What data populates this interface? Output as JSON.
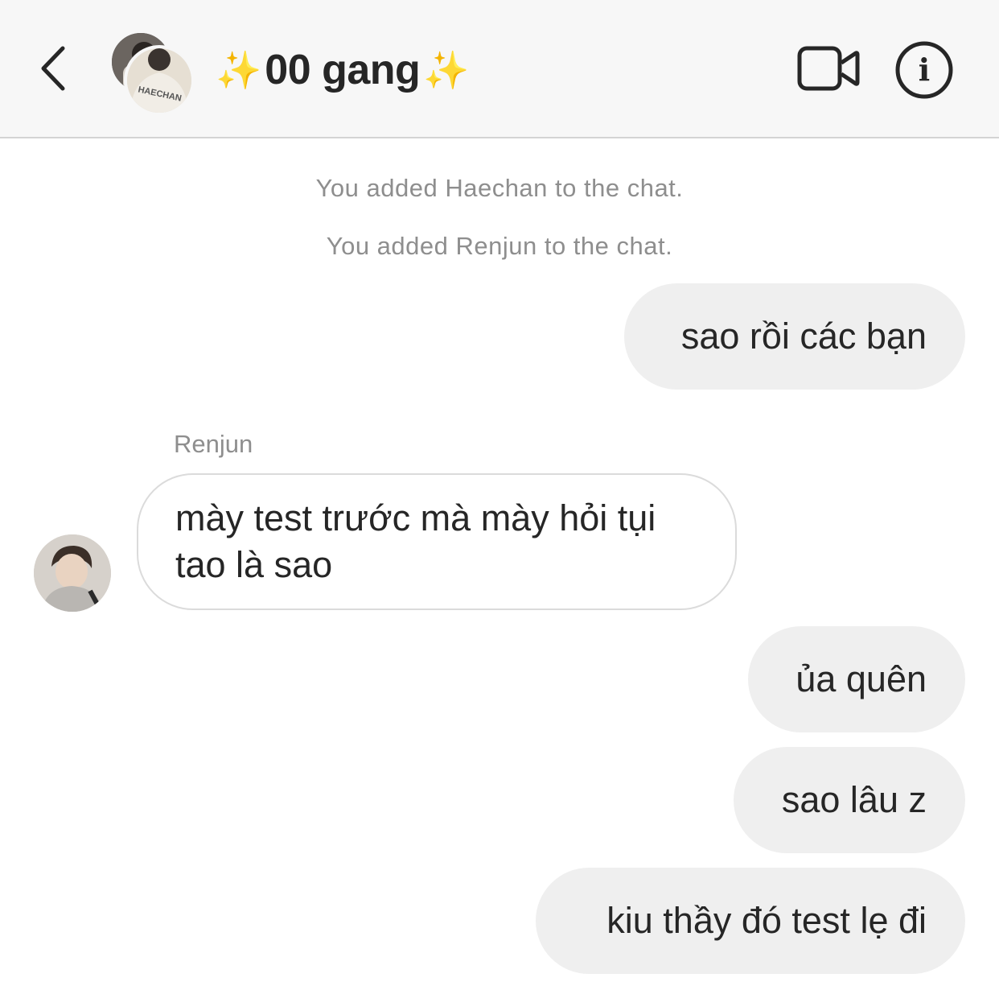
{
  "header": {
    "back_icon": "chevron-left-icon",
    "group_avatars": [
      {
        "name": "group-member-avatar",
        "shirt_text": ""
      },
      {
        "name": "haechan-avatar",
        "shirt_text": "HAECHAN"
      }
    ],
    "title_sparkle_left": "✨",
    "title": "00 gang",
    "title_sparkle_right": "✨",
    "video_icon": "video-camera-icon",
    "info_icon": "info-icon",
    "info_glyph": "i"
  },
  "system_messages": [
    "You added Haechan to the chat.",
    "You added Renjun to the chat."
  ],
  "messages": [
    {
      "direction": "outgoing",
      "text": "sao rồi các bạn"
    },
    {
      "direction": "incoming",
      "sender": "Renjun",
      "text": "mày test trước mà mày hỏi tụi\ntao là sao"
    },
    {
      "direction": "outgoing",
      "text": "ủa quên"
    },
    {
      "direction": "outgoing",
      "text": "sao lâu z"
    },
    {
      "direction": "outgoing",
      "text": "kiu thầy đó test lẹ đi"
    }
  ],
  "colors": {
    "header_bg": "#f7f7f7",
    "outgoing_bubble": "#efefef",
    "incoming_border": "#dbdbdb",
    "meta_text": "#8e8e8e",
    "text": "#262626"
  }
}
